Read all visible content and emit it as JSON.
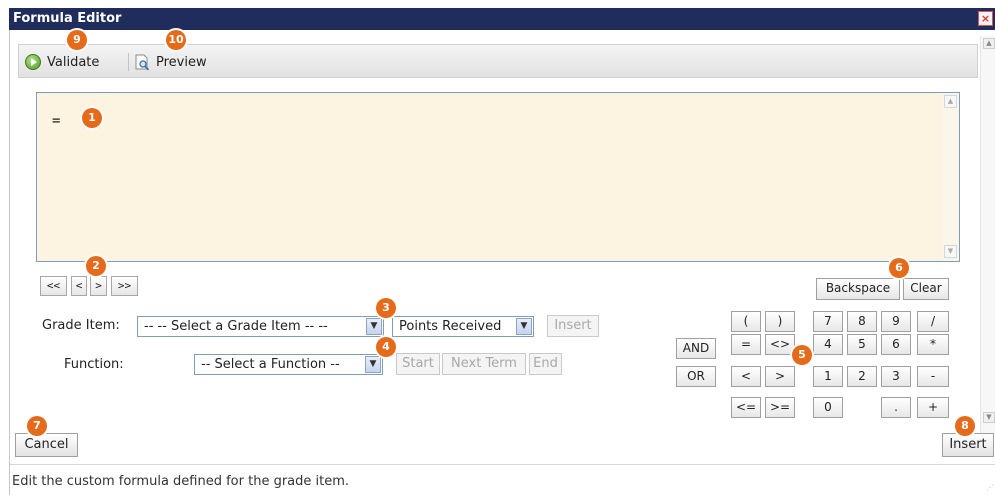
{
  "window": {
    "title": "Formula Editor",
    "close_glyph": "×"
  },
  "toolbar": {
    "validate_label": "Validate",
    "preview_label": "Preview"
  },
  "editor": {
    "content": "="
  },
  "nav": {
    "first": "<<",
    "prev": "<",
    "next": ">",
    "last": ">>"
  },
  "grade_item": {
    "label": "Grade Item:",
    "select_value": "-- -- Select a Grade Item -- --",
    "type_value": "Points Received",
    "insert_label": "Insert"
  },
  "function": {
    "label": "Function:",
    "select_value": "-- Select a Function --",
    "start_label": "Start",
    "next_term_label": "Next Term",
    "end_label": "End"
  },
  "logic": {
    "and_label": "AND",
    "or_label": "OR"
  },
  "keypad": {
    "backspace_label": "Backspace",
    "clear_label": "Clear",
    "lparen": "(",
    "rparen": ")",
    "eq": "=",
    "neq": "<>",
    "lt": "<",
    "gt": ">",
    "lte": "<=",
    "gte": ">=",
    "k7": "7",
    "k8": "8",
    "k9": "9",
    "div": "/",
    "k4": "4",
    "k5": "5",
    "k6": "6",
    "mul": "*",
    "k1": "1",
    "k2": "2",
    "k3": "3",
    "sub": "-",
    "k0": "0",
    "dot": ".",
    "add": "+"
  },
  "actions": {
    "cancel_label": "Cancel",
    "insert_label": "Insert"
  },
  "status": {
    "text": "Edit the custom formula defined for the grade item."
  },
  "callouts": {
    "c1": "1",
    "c2": "2",
    "c3": "3",
    "c4": "4",
    "c5": "5",
    "c6": "6",
    "c7": "7",
    "c8": "8",
    "c9": "9",
    "c10": "10"
  },
  "colors": {
    "titlebar": "#1f2c5c",
    "editor_bg": "#fcf3e0",
    "callout": "#e56a1a"
  }
}
